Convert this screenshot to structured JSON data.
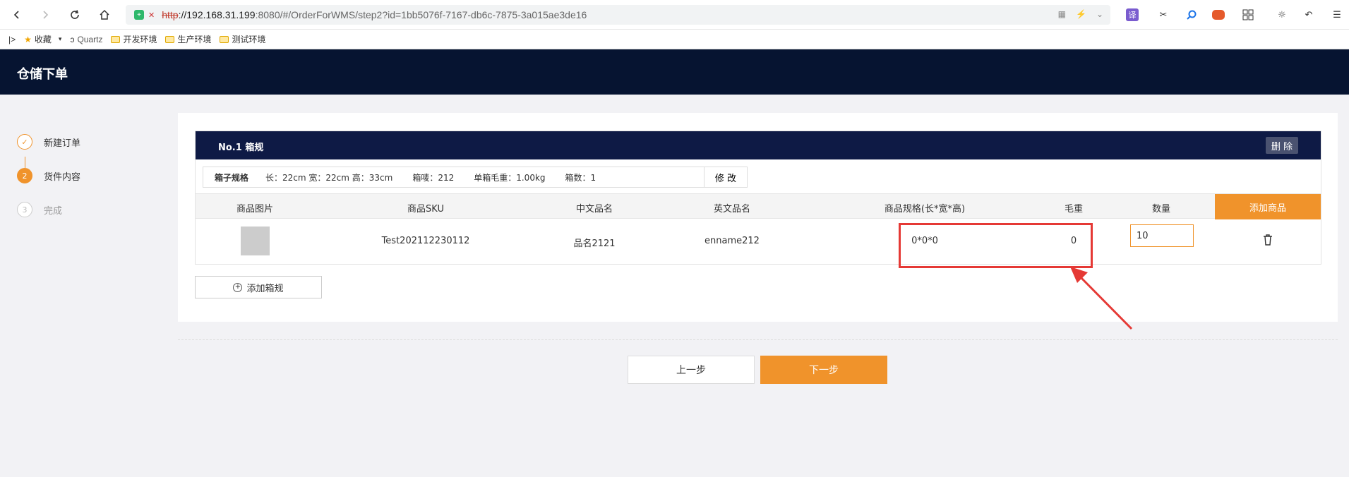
{
  "browser": {
    "url_proto": "http",
    "url_host": "://192.168.31.199",
    "url_rest": ":8080/#/OrderForWMS/step2?id=1bb5076f-7167-db6c-7875-3a015ae3de16",
    "bookmarks": [
      "收藏",
      "Quartz",
      "开发环境",
      "生产环境",
      "测试环境"
    ]
  },
  "app": {
    "title": "仓储下单"
  },
  "steps": [
    {
      "num": "✓",
      "label": "新建订单"
    },
    {
      "num": "2",
      "label": "货件内容"
    },
    {
      "num": "3",
      "label": "完成"
    }
  ],
  "box": {
    "title": "No.1 箱规",
    "delete_label": "删 除",
    "spec_label": "箱子规格",
    "dims": "长：22cm 宽：22cm 高：33cm",
    "box_mark": "箱唛：212",
    "weight": "单箱毛重：1.00kg",
    "count": "箱数：1",
    "edit_label": "修 改"
  },
  "table": {
    "headers": [
      "商品图片",
      "商品SKU",
      "中文品名",
      "英文品名",
      "商品规格(长*宽*高)",
      "毛重",
      "数量"
    ],
    "add_goods_label": "添加商品",
    "row": {
      "sku": "Test202112230112",
      "cn_name": "品名2121",
      "en_name": "enname212",
      "spec": "0*0*0",
      "weight": "0",
      "qty": "10"
    }
  },
  "add_spec_label": "添加箱规",
  "nav": {
    "prev": "上一步",
    "next": "下一步"
  },
  "colors": {
    "accent": "#f0932b",
    "header": "#061431",
    "annotation": "#e53935"
  }
}
